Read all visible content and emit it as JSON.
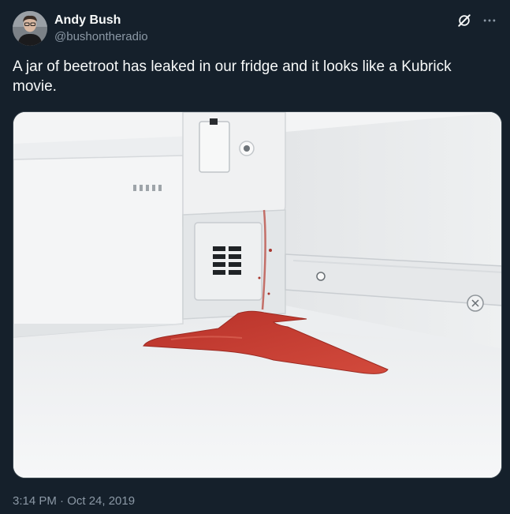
{
  "author": {
    "display_name": "Andy Bush",
    "handle": "@bushontheradio"
  },
  "header_icons": [
    "grok-icon",
    "more-icon"
  ],
  "tweet": {
    "text": "A jar of beetroot has leaked in our fridge and it looks like a Kubrick movie.",
    "timestamp": "3:14 PM · Oct 24, 2019"
  },
  "media": {
    "description_icon": "photo",
    "spill_color": "#c03a2e"
  }
}
